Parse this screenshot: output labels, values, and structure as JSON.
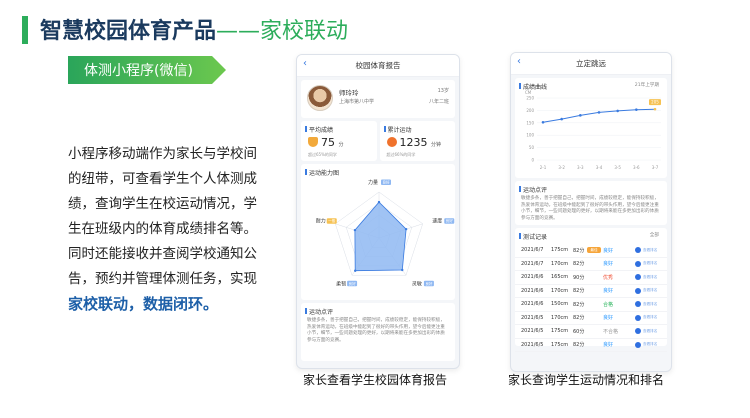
{
  "header": {
    "title_main": "智慧校园体育产品",
    "title_accent": "——家校联动"
  },
  "ribbon": {
    "label": "体测小程序(微信)"
  },
  "description": {
    "body": "小程序移动端作为家长与学校间的纽带，可查看学生个人体测成绩，查询学生在校运动情况，学生在班级内的体育成绩排名等。同时还能接收并查阅学校通知公告，预约并管理体测任务，实现",
    "highlight": "家校联动，数据闭环。"
  },
  "phone1": {
    "title": "校园体育报告",
    "back": "‹",
    "profile": {
      "name": "师玲玲",
      "age": "13岁",
      "school": "上海市第八中学",
      "grade": "八年二班"
    },
    "stat_avg": {
      "label": "平均成绩",
      "value": "75",
      "unit": "分",
      "foot": "超过65%的同学"
    },
    "stat_total": {
      "label": "累计运动",
      "value": "1235",
      "unit": "分钟",
      "foot": "超过66%的同学"
    },
    "radar": {
      "label": "运动能力图",
      "axes": [
        {
          "name": "力量",
          "badge": "良好"
        },
        {
          "name": "速度",
          "badge": "良好"
        },
        {
          "name": "灵敏",
          "badge": "良好"
        },
        {
          "name": "柔韧",
          "badge": "良好"
        },
        {
          "name": "耐力",
          "badge": "一般"
        }
      ],
      "values": [
        0.78,
        0.62,
        0.86,
        0.88,
        0.55
      ]
    },
    "comment": {
      "label": "运动点评",
      "text": "敏捷多条，善于把握自己，把握时间，成绩较稳定，能保持较积极，热爱体育运动，在班级中能起到了很好的带头作用，望今后能更注重小节，细节，一些问题处理的更好，以期将来能在多更加出彩的体质参与方面的竞赛。"
    }
  },
  "phone2": {
    "title": "立定跳远",
    "back": "‹",
    "chart_card": {
      "label": "成绩曲线",
      "period": "21年上学期",
      "unit": "CM"
    },
    "chart_data": {
      "type": "line",
      "categories": [
        "2-1",
        "3-2",
        "3-3",
        "3-4",
        "3-5",
        "3-6",
        "3-7"
      ],
      "values": [
        152,
        165,
        180,
        192,
        198,
        203,
        205
      ],
      "ylim": [
        0,
        250
      ],
      "yticks": [
        0,
        50,
        100,
        150,
        200,
        250
      ],
      "annotation": "205",
      "color": "#3a7be0"
    },
    "comment": {
      "label": "运动点评",
      "text": "敏捷多条，善于把握自己，把握时间，成绩较稳定，能保持较积极，热爱体育运动，在班级中能起到了很好的带头作用，望今后能更注重小节，细节，一些问题处理的更好，以期将来能在多更加出彩的体质参与方面的竞赛。"
    },
    "records": {
      "label": "测试记录",
      "filter": "全部",
      "rows": [
        {
          "date": "2021/6/7",
          "dist": "175cm",
          "pts": "82分",
          "badge": "最佳",
          "level": "良好",
          "color": "#2f9bff",
          "rank": "查看排名"
        },
        {
          "date": "2021/6/7",
          "dist": "170cm",
          "pts": "82分",
          "badge": "",
          "level": "良好",
          "color": "#2f9bff",
          "rank": "查看排名"
        },
        {
          "date": "2021/6/6",
          "dist": "165cm",
          "pts": "90分",
          "badge": "",
          "level": "优秀",
          "color": "#f0543a",
          "rank": "查看排名"
        },
        {
          "date": "2021/6/6",
          "dist": "170cm",
          "pts": "82分",
          "badge": "",
          "level": "良好",
          "color": "#2f9bff",
          "rank": "查看排名"
        },
        {
          "date": "2021/6/6",
          "dist": "150cm",
          "pts": "82分",
          "badge": "",
          "level": "合格",
          "color": "#27b35a",
          "rank": "查看排名"
        },
        {
          "date": "2021/6/5",
          "dist": "170cm",
          "pts": "82分",
          "badge": "",
          "level": "良好",
          "color": "#2f9bff",
          "rank": "查看排名"
        },
        {
          "date": "2021/6/5",
          "dist": "175cm",
          "pts": "60分",
          "badge": "",
          "level": "不合格",
          "color": "#999999",
          "rank": "查看排名"
        },
        {
          "date": "2021/6/5",
          "dist": "175cm",
          "pts": "82分",
          "badge": "",
          "level": "良好",
          "color": "#2f9bff",
          "rank": "查看排名"
        }
      ]
    }
  },
  "captions": {
    "left": "家长查看学生校园体育报告",
    "right": "家长查询学生运动情况和排名"
  }
}
